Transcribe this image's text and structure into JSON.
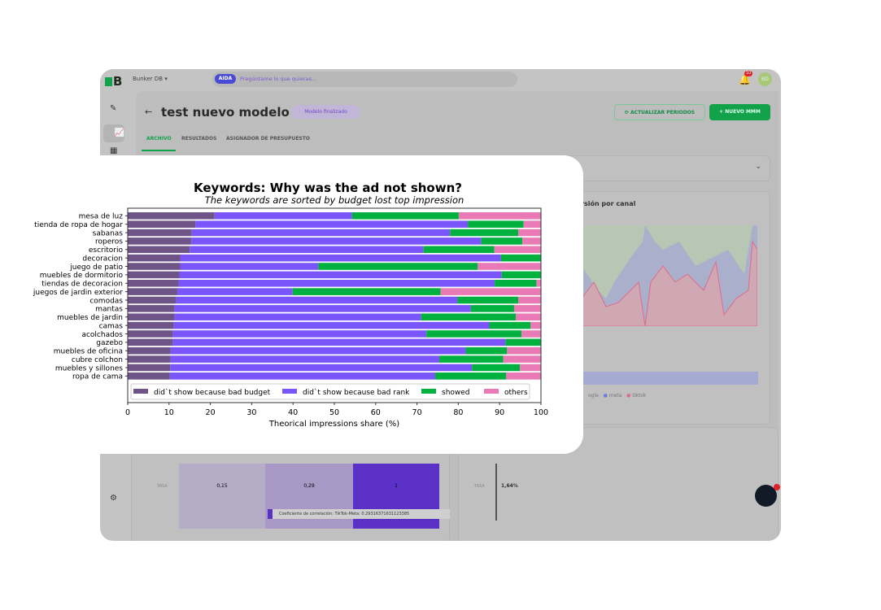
{
  "app": {
    "logo_text": "B",
    "workspace": "Bunker DB",
    "ai_badge": "AIDA",
    "search_placeholder": "Pregúntame lo que quieras...",
    "notification_count": "10",
    "avatar_initials": "BD",
    "page_title": "test nuevo modelo",
    "status_badge": "Modelo finalizado",
    "update_button": "ACTUALIZAR PERIODOS",
    "new_button": "NUEVO MMM",
    "tabs": [
      {
        "label": "ARCHIVO",
        "active": true
      },
      {
        "label": "RESULTADOS",
        "active": false
      },
      {
        "label": "ASIGNADOR DE PRESUPUESTO",
        "active": false
      }
    ],
    "channel_card_title": "rsión por canal",
    "channel_legend": [
      "ogle",
      "meta",
      "tiktok"
    ],
    "channel_colors": [
      "#9ccc9c",
      "#6a7ad8",
      "#e06a8a"
    ],
    "heatmap_row_label": "TASA",
    "heatmap_values": [
      "0,15",
      "0,29",
      "1"
    ],
    "heatmap_tooltip": "Coeficiente de correlación: TikTok-Meta: 0.29316371631123385",
    "rate_row_label": "TASA",
    "rate_value": "1,64%"
  },
  "chart_data": {
    "type": "bar",
    "orientation": "horizontal",
    "stacked": true,
    "title": "Keywords: Why was the ad not shown?",
    "subtitle": "The keywords are sorted by budget lost top impression",
    "xlabel": "Theorical impressions share (%)",
    "ylabel": "",
    "xlim": [
      0,
      100
    ],
    "xticks": [
      "0",
      "10",
      "20",
      "30",
      "40",
      "50",
      "60",
      "70",
      "80",
      "90",
      "100"
    ],
    "legend_position": "bottom-inside",
    "grid": false,
    "categories": [
      "mesa de luz",
      "tienda de ropa de hogar",
      "sabanas",
      "roperos",
      "escritorio",
      "decoracion",
      "juego de patio",
      "muebles de dormitorio",
      "tiendas de decoracion",
      "juegos de jardin exterior",
      "comodas",
      "mantas",
      "muebles de jardin",
      "camas",
      "acolchados",
      "gazebo",
      "muebles de oficina",
      "cubre colchon",
      "muebles y sillones",
      "ropa de cama"
    ],
    "series": [
      {
        "name": "did`t show because bad budget",
        "color": "#6f5487",
        "values": [
          21.0,
          16.4,
          15.5,
          15.4,
          15.0,
          12.7,
          12.7,
          12.5,
          12.3,
          12.0,
          11.7,
          11.3,
          11.3,
          11.1,
          10.9,
          10.9,
          10.4,
          10.4,
          10.3,
          10.2
        ]
      },
      {
        "name": "did`t show because bad rank",
        "color": "#7a55fb",
        "values": [
          33.3,
          65.9,
          62.5,
          70.1,
          56.6,
          77.6,
          33.4,
          78.0,
          76.5,
          27.9,
          68.1,
          71.7,
          59.7,
          76.4,
          61.4,
          80.5,
          71.4,
          65.0,
          73.0,
          64.2
        ]
      },
      {
        "name": "showed",
        "color": "#00b140",
        "values": [
          25.8,
          13.5,
          16.5,
          10.0,
          17.1,
          9.7,
          38.6,
          9.5,
          10.1,
          35.8,
          14.7,
          10.5,
          22.9,
          10.0,
          23.0,
          8.6,
          10.0,
          15.5,
          11.6,
          17.2
        ]
      },
      {
        "name": "others",
        "color": "#e97ab5",
        "values": [
          19.9,
          4.2,
          5.5,
          4.5,
          11.3,
          0.0,
          15.3,
          0.0,
          1.1,
          24.3,
          5.5,
          6.5,
          6.1,
          2.5,
          4.7,
          0.0,
          8.2,
          9.1,
          5.1,
          8.4
        ]
      }
    ]
  }
}
